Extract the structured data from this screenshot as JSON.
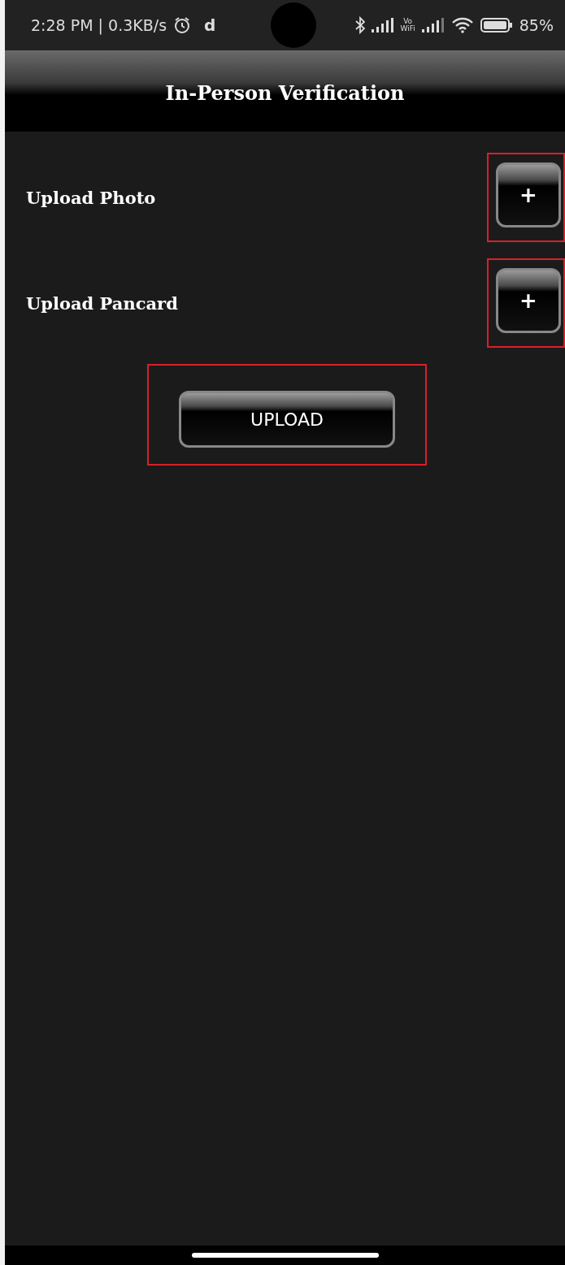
{
  "status_bar": {
    "time": "2:28 PM | 0.3KB/s",
    "notification": "d",
    "vowifi": [
      "Vo",
      "WiFi"
    ],
    "battery": "85%"
  },
  "header": {
    "title": "In-Person Verification"
  },
  "rows": [
    {
      "label": "Upload Photo",
      "button": "+",
      "highlighted": true
    },
    {
      "label": "Upload Pancard",
      "button": "+",
      "highlighted": true
    }
  ],
  "upload_button": {
    "label": "UPLOAD",
    "highlighted": true
  }
}
